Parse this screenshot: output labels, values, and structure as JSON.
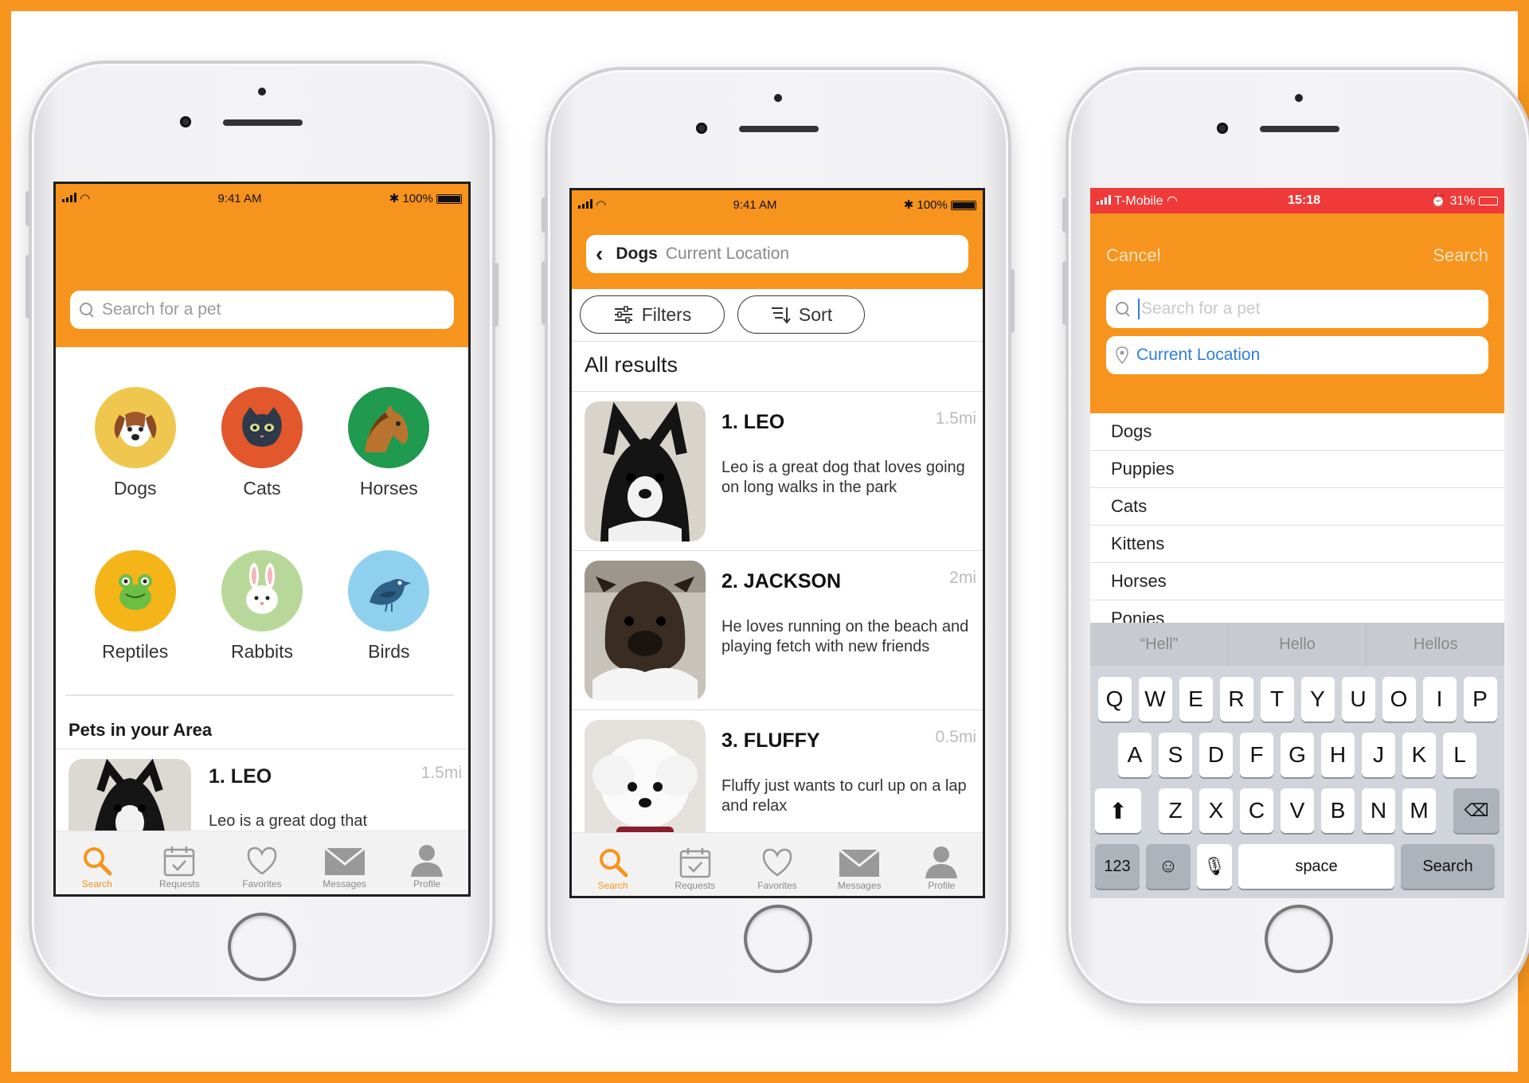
{
  "colors": {
    "brand": "#F7941D",
    "ios_status_red": "#F03A3A",
    "link_blue": "#2F7DE1"
  },
  "phone1": {
    "status": {
      "time": "9:41 AM",
      "battery": "100%"
    },
    "search_placeholder": "Search for a pet",
    "categories": [
      {
        "label": "Dogs",
        "icon": "dog-icon",
        "bg": "#EFC74E"
      },
      {
        "label": "Cats",
        "icon": "cat-icon",
        "bg": "#E2572B"
      },
      {
        "label": "Horses",
        "icon": "horse-icon",
        "bg": "#1F9A4E"
      },
      {
        "label": "Reptiles",
        "icon": "frog-icon",
        "bg": "#F5B418"
      },
      {
        "label": "Rabbits",
        "icon": "rabbit-icon",
        "bg": "#B8D89A"
      },
      {
        "label": "Birds",
        "icon": "bird-icon",
        "bg": "#8FD0EE"
      }
    ],
    "section_title": "Pets in your Area",
    "preview": {
      "title": "1. LEO",
      "distance": "1.5mi",
      "description": "Leo is a great dog that"
    }
  },
  "tabs": [
    {
      "label": "Search",
      "icon": "search-icon"
    },
    {
      "label": "Requests",
      "icon": "calendar-check-icon"
    },
    {
      "label": "Favorites",
      "icon": "heart-icon"
    },
    {
      "label": "Messages",
      "icon": "envelope-icon"
    },
    {
      "label": "Profile",
      "icon": "person-icon"
    }
  ],
  "phone2": {
    "status": {
      "time": "9:41 AM",
      "battery": "100%"
    },
    "query": {
      "term": "Dogs",
      "location": "Current Location"
    },
    "filters_label": "Filters",
    "sort_label": "Sort",
    "results_heading": "All results",
    "results": [
      {
        "title": "1. LEO",
        "distance": "1.5mi",
        "description": "Leo is a great dog that loves going on long walks in the park"
      },
      {
        "title": "2. JACKSON",
        "distance": "2mi",
        "description": "He loves running on the beach and playing fetch with new friends"
      },
      {
        "title": "3. FLUFFY",
        "distance": "0.5mi",
        "description": "Fluffy just wants to curl up on a lap and relax"
      }
    ]
  },
  "phone3": {
    "status": {
      "carrier": "T-Mobile",
      "time": "15:18",
      "battery": "31%"
    },
    "cancel_label": "Cancel",
    "search_label": "Search",
    "search_placeholder": "Search for a pet",
    "location_label": "Current Location",
    "suggestions": [
      "Dogs",
      "Puppies",
      "Cats",
      "Kittens",
      "Horses",
      "Ponies"
    ],
    "predictions": [
      "“Hell”",
      "Hello",
      "Hellos"
    ],
    "keyboard": {
      "row1": [
        "Q",
        "W",
        "E",
        "R",
        "T",
        "Y",
        "U",
        "O",
        "I",
        "P"
      ],
      "row2": [
        "A",
        "S",
        "D",
        "F",
        "G",
        "H",
        "J",
        "K",
        "L"
      ],
      "row3": [
        "Z",
        "X",
        "C",
        "V",
        "B",
        "N",
        "M"
      ],
      "numbers_label": "123",
      "space_label": "space",
      "return_label": "Search"
    }
  }
}
